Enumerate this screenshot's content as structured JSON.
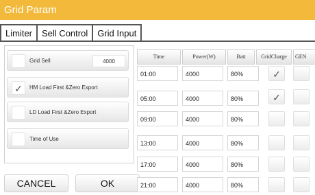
{
  "window": {
    "title": "Grid Param"
  },
  "tabs": [
    {
      "label": "Limiter"
    },
    {
      "label": "Sell Control"
    },
    {
      "label": "Grid Input"
    }
  ],
  "options": {
    "grid_sell": {
      "label": "Grid Sell",
      "value": "4000",
      "checked": false
    },
    "hm_load": {
      "label": "HM Load First &Zero Export",
      "checked": true
    },
    "ld_load": {
      "label": "LD Load First &Zero Export",
      "checked": false
    },
    "time_of_use": {
      "label": "Time of Use",
      "checked": false
    }
  },
  "buttons": {
    "cancel": "CANCEL",
    "ok": "OK"
  },
  "schedule": {
    "headers": [
      "Time",
      "Power(W)",
      "Batt",
      "GridCharge",
      "GEN"
    ],
    "rows": [
      {
        "time": "01:00",
        "power": "4000",
        "batt": "80%",
        "grid_charge": true
      },
      {
        "time": "05:00",
        "power": "4000",
        "batt": "80%",
        "grid_charge": true
      },
      {
        "time": "09:00",
        "power": "4000",
        "batt": "80%",
        "grid_charge": false
      },
      {
        "time": "13:00",
        "power": "4000",
        "batt": "80%",
        "grid_charge": false
      },
      {
        "time": "17:00",
        "power": "4000",
        "batt": "80%",
        "grid_charge": false
      },
      {
        "time": "21:00",
        "power": "4000",
        "batt": "80%",
        "grid_charge": false
      }
    ]
  },
  "colors": {
    "accent": "#f2b93b"
  },
  "icons": {
    "check": "check-icon"
  }
}
